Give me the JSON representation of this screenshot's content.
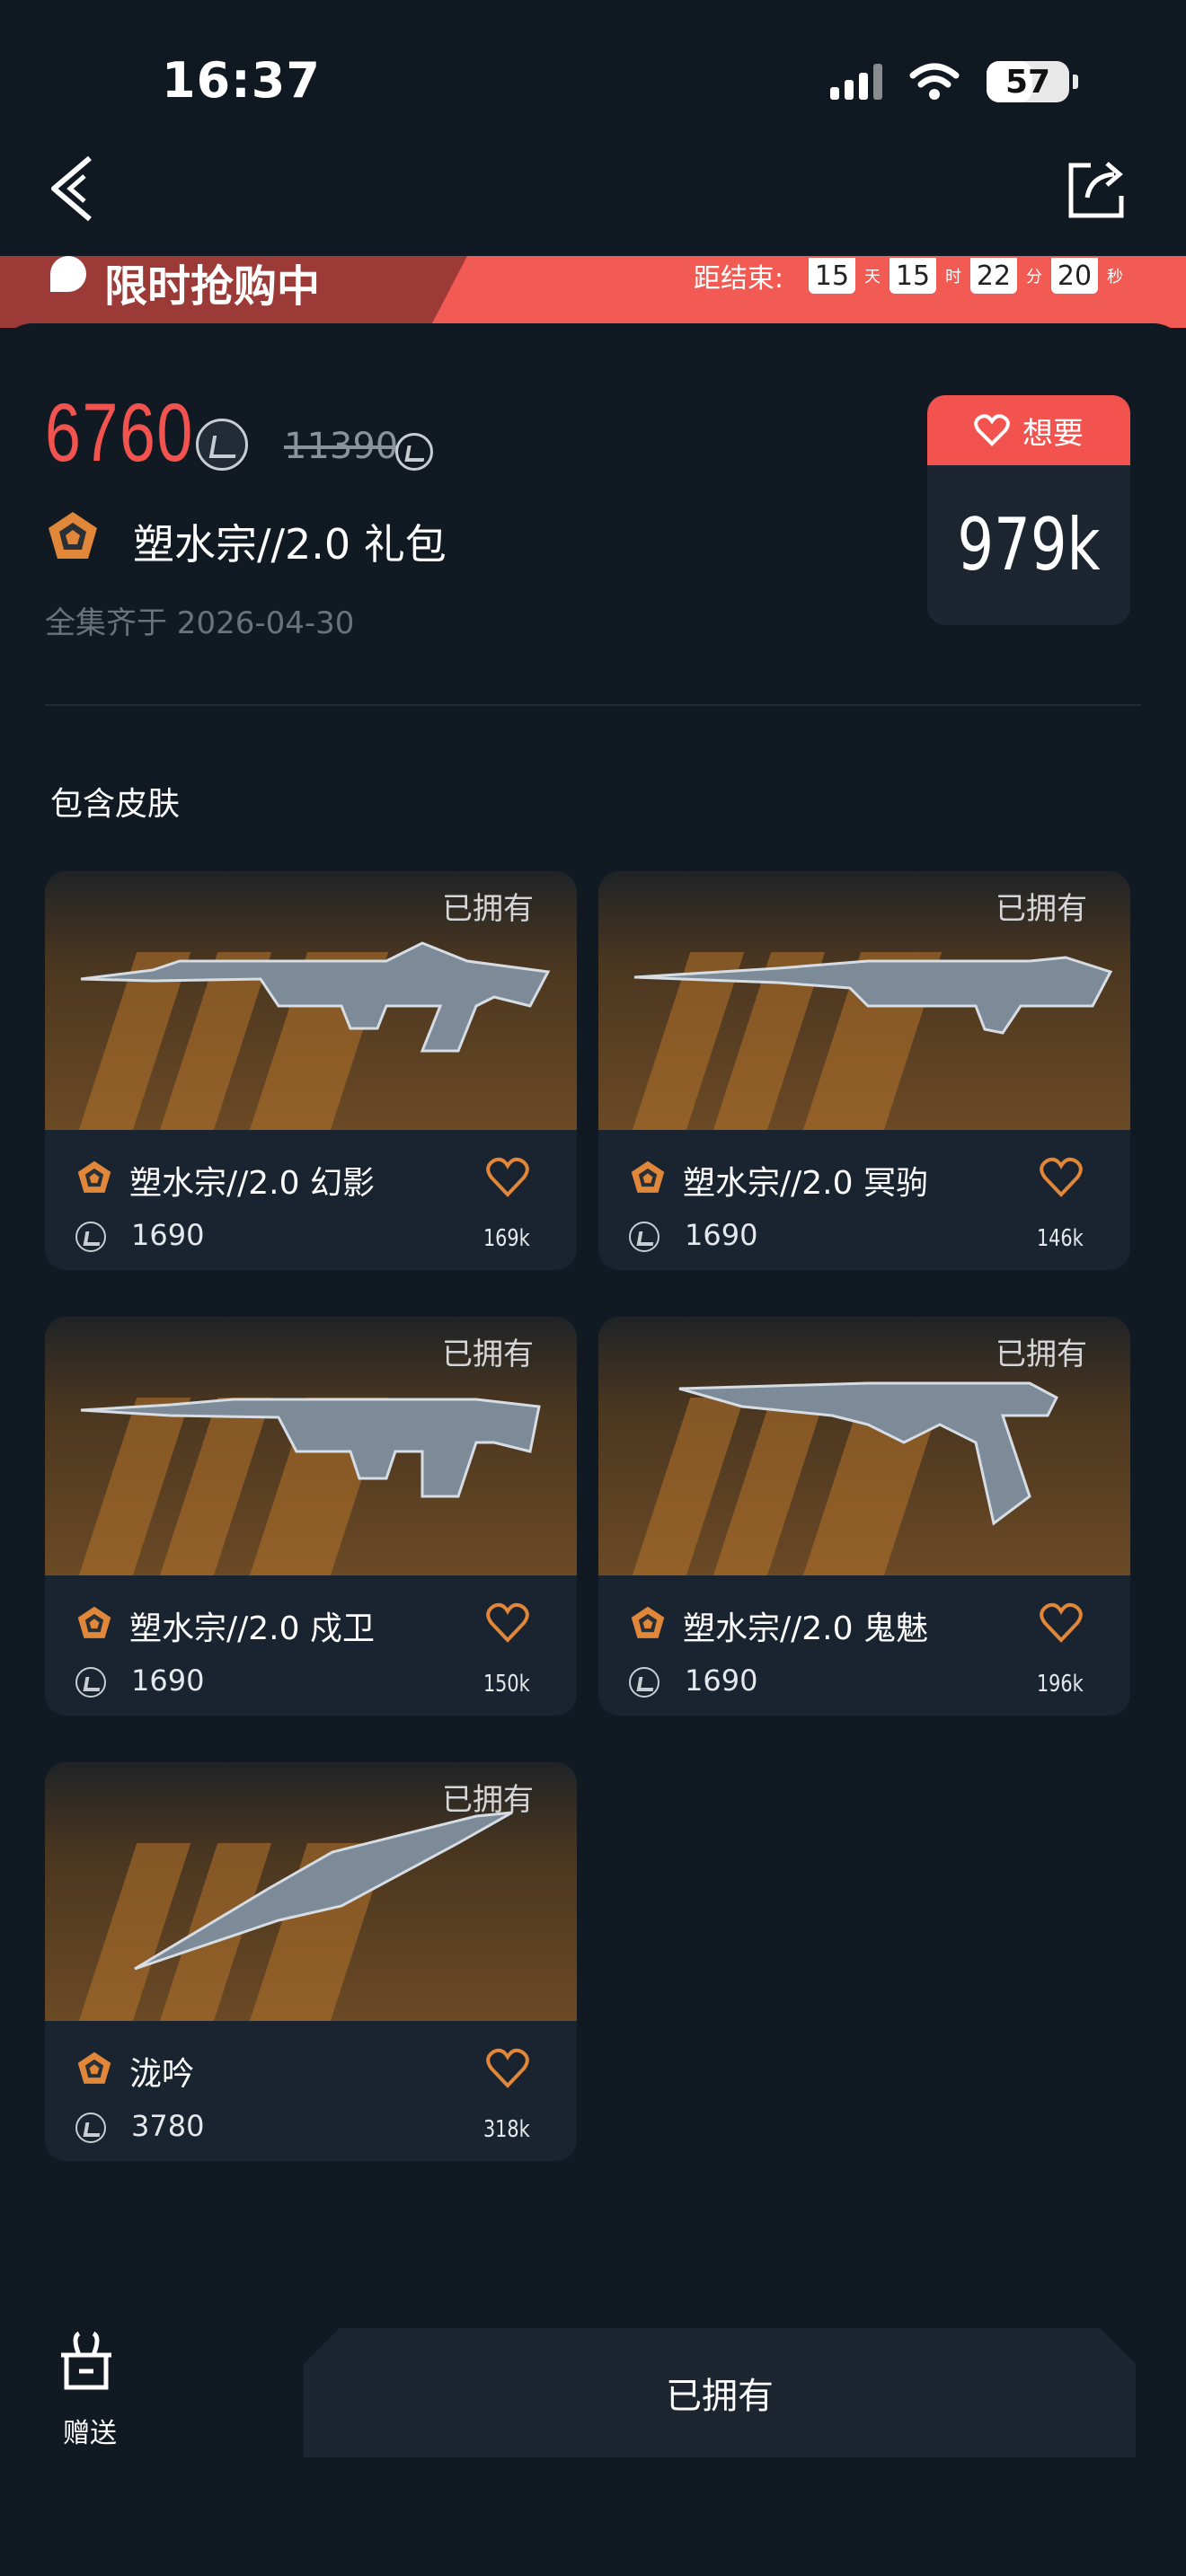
{
  "status_bar": {
    "time": "16:37",
    "battery": "57"
  },
  "nav": {
    "back_icon": "chevron-left-icon",
    "share_icon": "share-icon"
  },
  "promo": {
    "title": "限时抢购中",
    "countdown_label": "距结束:",
    "days": "15",
    "days_unit": "天",
    "hours": "15",
    "hours_unit": "时",
    "minutes": "22",
    "minutes_unit": "分",
    "seconds": "20",
    "seconds_unit": "秒"
  },
  "bundle": {
    "price": "6760",
    "original_price": "11390",
    "name": "塑水宗//2.0 礼包",
    "complete_date": "全集齐于 2026-04-30",
    "want_label": "想要",
    "want_count": "979k"
  },
  "section_title": "包含皮肤",
  "skins": [
    {
      "owned": "已拥有",
      "name": "塑水宗//2.0 幻影",
      "price": "1690",
      "likes": "169k"
    },
    {
      "owned": "已拥有",
      "name": "塑水宗//2.0 冥驹",
      "price": "1690",
      "likes": "146k"
    },
    {
      "owned": "已拥有",
      "name": "塑水宗//2.0 戍卫",
      "price": "1690",
      "likes": "150k"
    },
    {
      "owned": "已拥有",
      "name": "塑水宗//2.0 鬼魅",
      "price": "1690",
      "likes": "196k"
    },
    {
      "owned": "已拥有",
      "name": "泷吟",
      "price": "3780",
      "likes": "318k"
    }
  ],
  "footer": {
    "gift_label": "赠送",
    "owned_label": "已拥有"
  },
  "colors": {
    "accent": "#f2534f",
    "tier": "#e0873a",
    "background": "#101821"
  }
}
